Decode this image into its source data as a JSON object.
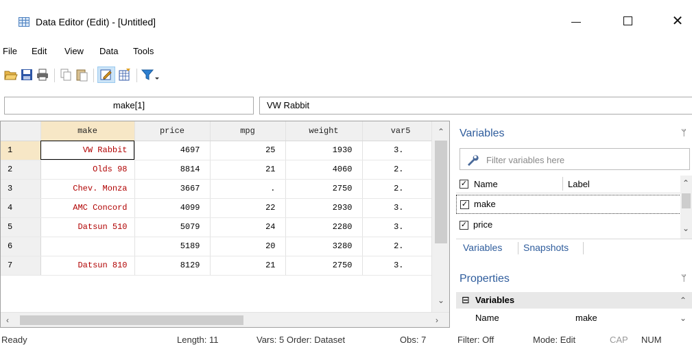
{
  "window": {
    "title": "Data Editor (Edit) - [Untitled]",
    "min_glyph": "—",
    "max_glyph": "☐",
    "close_glyph": "✕"
  },
  "menu": [
    "File",
    "Edit",
    "View",
    "Data",
    "Tools"
  ],
  "toolbar": {
    "icons": [
      "open-icon",
      "save-icon",
      "print-icon",
      "copy-icon",
      "paste-icon",
      "edit-mode-icon",
      "browse-mode-icon",
      "filter-icon"
    ]
  },
  "cell_ref": {
    "name": "make[1]",
    "value": "VW Rabbit"
  },
  "grid": {
    "columns": [
      "make",
      "price",
      "mpg",
      "weight",
      "var5"
    ],
    "rows": [
      {
        "n": "1",
        "make": "VW Rabbit",
        "price": "4697",
        "mpg": "25",
        "weight": "1930",
        "var5": "3."
      },
      {
        "n": "2",
        "make": "Olds 98",
        "price": "8814",
        "mpg": "21",
        "weight": "4060",
        "var5": "2."
      },
      {
        "n": "3",
        "make": "Chev. Monza",
        "price": "3667",
        "mpg": ".",
        "weight": "2750",
        "var5": "2."
      },
      {
        "n": "4",
        "make": "AMC Concord",
        "price": "4099",
        "mpg": "22",
        "weight": "2930",
        "var5": "3."
      },
      {
        "n": "5",
        "make": "Datsun 510",
        "price": "5079",
        "mpg": "24",
        "weight": "2280",
        "var5": "3."
      },
      {
        "n": "6",
        "make": "",
        "price": "5189",
        "mpg": "20",
        "weight": "3280",
        "var5": "2."
      },
      {
        "n": "7",
        "make": "Datsun 810",
        "price": "8129",
        "mpg": "21",
        "weight": "2750",
        "var5": "3."
      }
    ]
  },
  "variables_panel": {
    "title": "Variables",
    "pin_glyph": "ᛘ",
    "filter_placeholder": "Filter variables here",
    "header_name": "Name",
    "header_label": "Label",
    "items": [
      {
        "name": "make",
        "checked": "✓"
      },
      {
        "name": "price",
        "checked": "✓"
      }
    ],
    "head_check": "✓",
    "tabs": [
      "Variables",
      "Snapshots"
    ]
  },
  "properties_panel": {
    "title": "Properties",
    "group_label": "Variables",
    "group_glyph": "⊟",
    "row_name": "Name",
    "row_value": "make"
  },
  "status": {
    "ready": "Ready",
    "length": "Length: 11",
    "vars_order": "Vars: 5  Order: Dataset",
    "obs": "Obs: 7",
    "filter": "Filter: Off",
    "mode": "Mode: Edit",
    "cap": "CAP",
    "num": "NUM"
  }
}
